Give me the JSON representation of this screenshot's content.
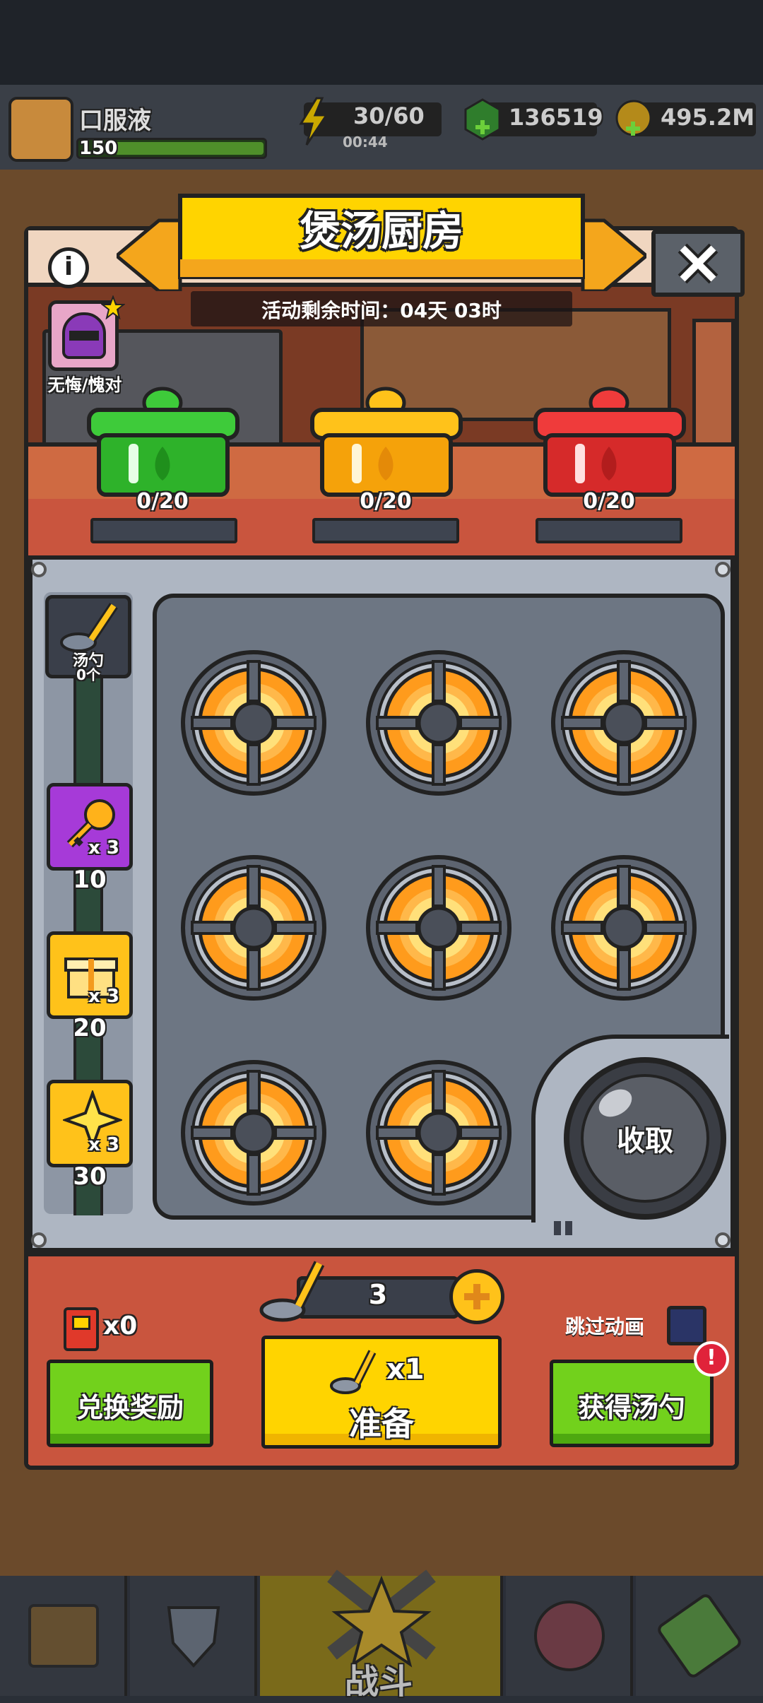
{
  "topbar": {
    "player_name": "口服液",
    "player_level": "150",
    "energy": "30/60",
    "energy_timer": "00:44",
    "gems": "136519",
    "gold": "495.2M"
  },
  "modal": {
    "title": "煲汤厨房",
    "countdown": "活动剩余时间：04天 03时",
    "character_label": "无悔/愧对",
    "pots": [
      {
        "color": "green",
        "progress": "0/20"
      },
      {
        "color": "yellow",
        "progress": "0/20"
      },
      {
        "color": "red",
        "progress": "0/20"
      }
    ],
    "ladle_label": "汤勺",
    "ladle_count": "0个",
    "rewards": [
      {
        "icon": "key-icon",
        "multiplier": "x 3",
        "threshold": "10"
      },
      {
        "icon": "gift-box-icon",
        "multiplier": "x 3",
        "threshold": "20"
      },
      {
        "icon": "star-icon",
        "multiplier": "x 3",
        "threshold": "30"
      }
    ],
    "collect_label": "收取",
    "ticket_count": "x0",
    "ladle_amount": "3",
    "skip_label": "跳过动画",
    "exchange_label": "兑换奖励",
    "prepare_multiplier": "x1",
    "prepare_label": "准备",
    "get_ladle_label": "获得汤勺"
  },
  "bottom_nav": {
    "battle_label": "战斗"
  },
  "colors": {
    "accent_yellow": "#ffd400",
    "green_button": "#72d11c",
    "panel_red": "#c9553e"
  }
}
